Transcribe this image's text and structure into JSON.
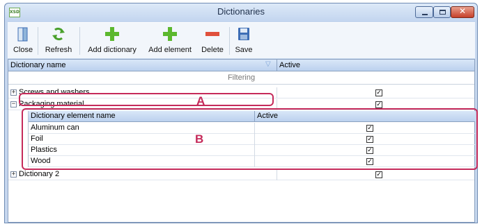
{
  "window": {
    "title": "Dictionaries",
    "app_icon_text": "XSD"
  },
  "toolbar": {
    "buttons": [
      {
        "label": "Close",
        "icon": "close-door-icon"
      },
      {
        "label": "Refresh",
        "icon": "refresh-icon"
      },
      {
        "label": "Add dictionary",
        "icon": "add-icon"
      },
      {
        "label": "Add element",
        "icon": "add-icon"
      },
      {
        "label": "Delete",
        "icon": "delete-icon"
      },
      {
        "label": "Save",
        "icon": "save-icon"
      }
    ]
  },
  "grid": {
    "columns": [
      "Dictionary name",
      "Active"
    ],
    "filter_label": "Filtering",
    "rows": [
      {
        "name": "Screws and washers",
        "expanded": false,
        "active": true
      },
      {
        "name": "Packaging material",
        "expanded": true,
        "active": true
      },
      {
        "name": "Dictionary 2",
        "expanded": false,
        "active": true
      }
    ],
    "detail": {
      "columns": [
        "Dictionary element name",
        "Active"
      ],
      "rows": [
        {
          "name": "Aluminum can",
          "active": true
        },
        {
          "name": "Foil",
          "active": true
        },
        {
          "name": "Plastics",
          "active": true
        },
        {
          "name": "Wood",
          "active": true
        }
      ]
    }
  },
  "annotations": {
    "a": "A",
    "b": "B"
  },
  "colors": {
    "annotation": "#c52a5a",
    "header": "#bcd1ee",
    "accent_green": "#5cb82e",
    "accent_red": "#e0503c",
    "save_blue": "#3d6db5"
  }
}
